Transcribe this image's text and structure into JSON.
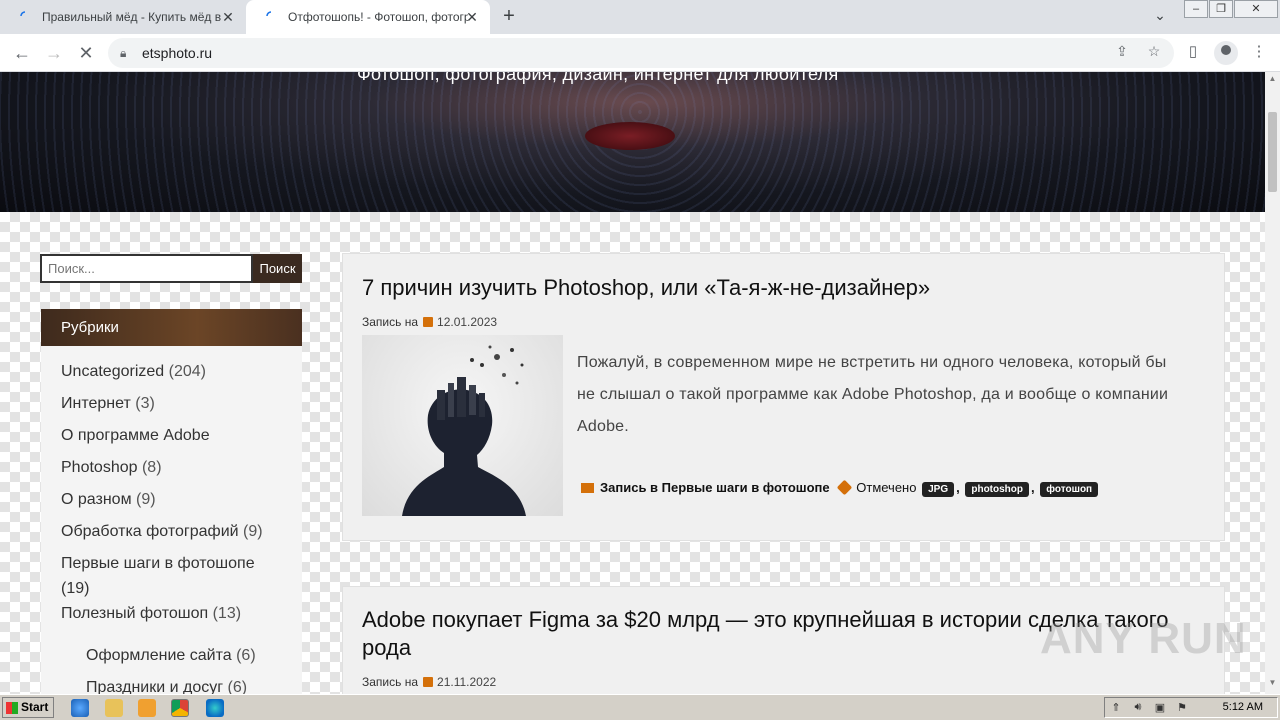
{
  "browser": {
    "tabs": [
      {
        "title": "Правильный мёд - Купить мёд в К",
        "active": false
      },
      {
        "title": "Отфотошопь! - Фотошоп, фотогр",
        "active": true
      }
    ],
    "url": "etsphoto.ru"
  },
  "header": {
    "tagline": "Фотошоп, фотография, дизайн, интернет для любителя"
  },
  "sidebar": {
    "search_placeholder": "Поиск...",
    "search_button": "Поиск",
    "widget_title": "Рубрики",
    "categories": [
      {
        "name": "Uncategorized",
        "count": "(204)"
      },
      {
        "name": "Интернет",
        "count": "(3)"
      },
      {
        "name": "О программе Adobe",
        "count": ""
      },
      {
        "name": "Photoshop",
        "count": "(8)"
      },
      {
        "name": "О разном",
        "count": "(9)"
      },
      {
        "name": "Обработка фотографий",
        "count": "(9)"
      },
      {
        "name": "Первые шаги в фотошопе",
        "count": ""
      },
      {
        "name": "(19)",
        "count": ""
      },
      {
        "name": "Полезный фотошоп",
        "count": "(13)"
      },
      {
        "name": "Оформление сайта",
        "count": "(6)"
      },
      {
        "name": "Праздники и досуг",
        "count": "(6)"
      }
    ]
  },
  "posts": [
    {
      "title": "7 причин изучить Photoshop, или «Та-я-ж-не-дизайнер»",
      "meta_label": "Запись на",
      "date": "12.01.2023",
      "excerpt": "Пожалуй, в современном мире не встретить ни одного человека, который бы не слышал о такой программе как Adobe Photoshop, да и вообще о компании Adobe.",
      "posted_in_label": "Запись в",
      "category": "Первые шаги в фотошопе",
      "tagged_label": "Отмечено",
      "tags": [
        "JPG",
        "photoshop",
        "фотошоп"
      ],
      "separator": ","
    },
    {
      "title": "Adobe покупает Figma за $20 млрд — это крупнейшая в истории сделка такого рода",
      "meta_label": "Запись на",
      "date": "21.11.2022"
    }
  ],
  "watermark": "ANY RUN",
  "taskbar": {
    "start_label": "Start",
    "clock": "5:12 AM"
  }
}
